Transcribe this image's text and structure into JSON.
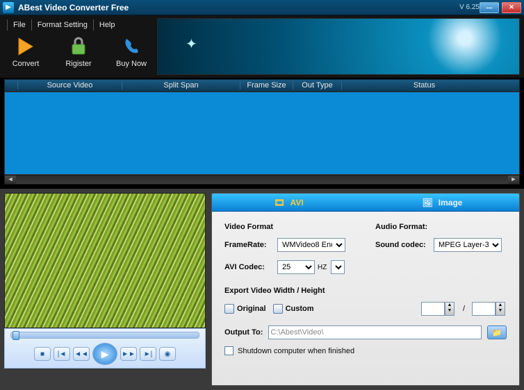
{
  "titlebar": {
    "title": "ABest Video Converter Free",
    "version": "V 6.25"
  },
  "menu": {
    "file": "File",
    "format": "Format Setting",
    "help": "Help"
  },
  "toolbar": {
    "convert": "Convert",
    "register": "Rigister",
    "buynow": "Buy Now"
  },
  "grid": {
    "cols": {
      "source": "Source Video",
      "split": "Split Span",
      "frame": "Frame Size",
      "outtype": "Out Type",
      "status": "Status"
    }
  },
  "tabs": {
    "avi": "AVI",
    "image": "Image"
  },
  "settings": {
    "video_format": "Video Format",
    "audio_format": "Audio Format:",
    "framerate_lbl": "FrameRate:",
    "framerate_val": "WMVideo8 Enc",
    "codec_lbl": "AVI Codec:",
    "codec_val": "25",
    "hz": "HZ",
    "soundcodec_lbl": "Sound codec:",
    "soundcodec_val": "MPEG Layer-3",
    "export_lbl": "Export Video Width / Height",
    "original": "Original",
    "custom": "Custom",
    "output_lbl": "Output To:",
    "output_val": "C:\\Abest\\Video\\",
    "shutdown": "Shutdown computer when finished"
  }
}
